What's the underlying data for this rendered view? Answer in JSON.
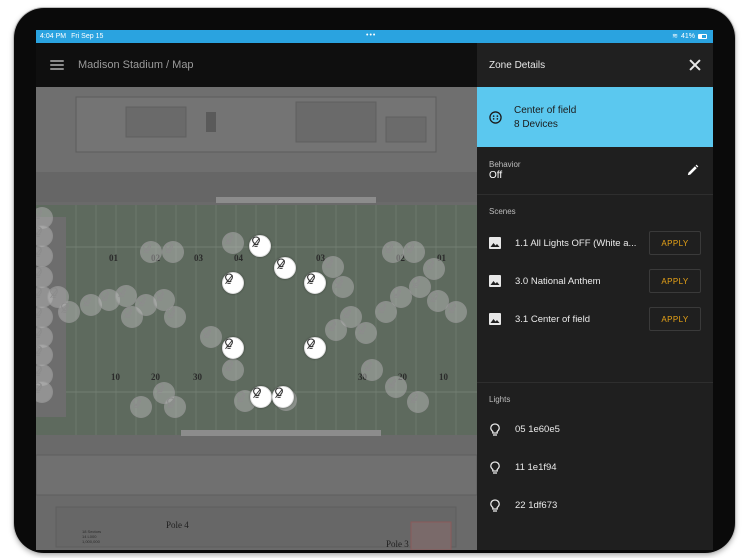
{
  "status": {
    "time": "4:04 PM",
    "date": "Fri Sep 15",
    "dots": "•••",
    "wifi": "≋",
    "battery": "41%"
  },
  "app": {
    "breadcrumb": "Madison Stadium / Map"
  },
  "map": {
    "yard_top": [
      "01",
      "02",
      "03",
      "04",
      "03",
      "02",
      "01"
    ],
    "yard_bottom": [
      "10",
      "20",
      "30",
      "30",
      "20",
      "10"
    ],
    "poles": [
      "Pole 4",
      "Pole 3"
    ],
    "tiny_note": "18 Sectors\n14 L000\n1,000,000"
  },
  "panel": {
    "title": "Zone Details",
    "zone": {
      "name": "Center of field",
      "devices": "8 Devices"
    },
    "behavior": {
      "label": "Behavior",
      "value": "Off"
    },
    "scenes_title": "Scenes",
    "scenes": [
      {
        "name": "1.1 All Lights OFF (White a...",
        "action": "APPLY"
      },
      {
        "name": "3.0 National Anthem",
        "action": "APPLY"
      },
      {
        "name": "3.1 Center of field",
        "action": "APPLY"
      }
    ],
    "lights_title": "Lights",
    "lights": [
      {
        "name": "05 1e60e5"
      },
      {
        "name": "11 1e1f94"
      },
      {
        "name": "22 1df673"
      }
    ]
  },
  "colors": {
    "status_bar": "#2aa3e0",
    "zone_card": "#5bc8ef",
    "apply": "#e8a317",
    "panel": "#1f1f1f"
  }
}
